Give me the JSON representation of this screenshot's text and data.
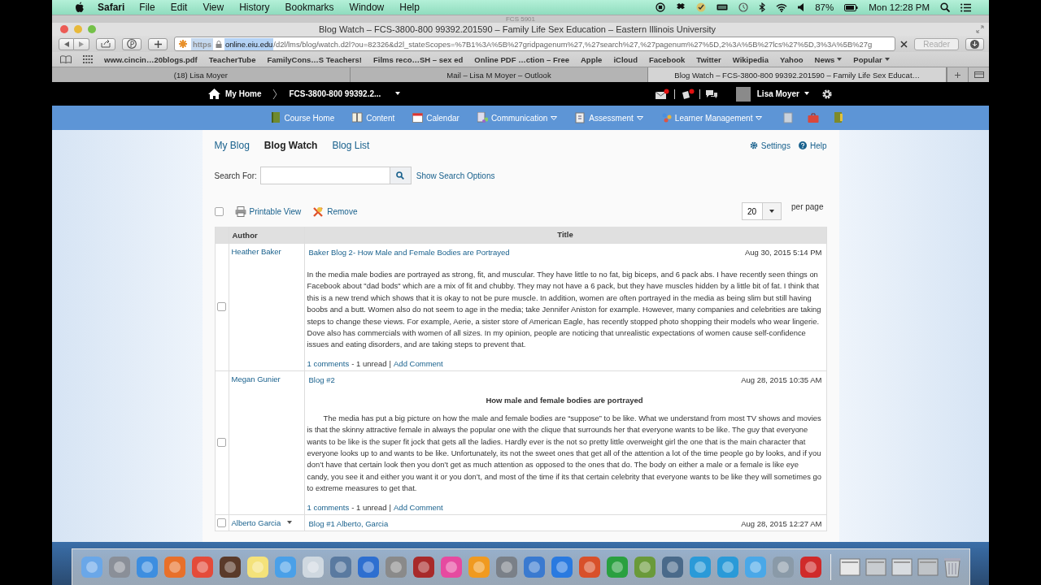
{
  "menu_bar": {
    "app": "Safari",
    "items": [
      "File",
      "Edit",
      "View",
      "History",
      "Bookmarks",
      "Window",
      "Help"
    ],
    "battery": "87%",
    "clock": "Mon 12:28 PM"
  },
  "background_window": {
    "title": "FCS 5901"
  },
  "window": {
    "title": "Blog Watch – FCS-3800-800 99392.201590 – Family Life Sex Education – Eastern Illinois University"
  },
  "address_bar": {
    "scheme": "https",
    "host": "online.eiu.edu",
    "path": "/d2l/lms/blog/watch.d2l?ou=82326&d2l_stateScopes=%7B1%3A%5B%27gridpagenum%27,%27search%27,%27pagenum%27%5D,2%3A%5B%27lcs%27%5D,3%3A%5B%27g",
    "reader": "Reader"
  },
  "bookmarks": [
    {
      "label": "www.cincin…20blogs.pdf",
      "menu": false
    },
    {
      "label": "TeacherTube",
      "menu": false
    },
    {
      "label": "FamilyCons…S Teachers!",
      "menu": false
    },
    {
      "label": "Films reco…SH – sex ed",
      "menu": false
    },
    {
      "label": "Online PDF …ction – Free",
      "menu": false
    },
    {
      "label": "Apple",
      "menu": false
    },
    {
      "label": "iCloud",
      "menu": false
    },
    {
      "label": "Facebook",
      "menu": false
    },
    {
      "label": "Twitter",
      "menu": false
    },
    {
      "label": "Wikipedia",
      "menu": false
    },
    {
      "label": "Yahoo",
      "menu": false
    },
    {
      "label": "News",
      "menu": true
    },
    {
      "label": "Popular",
      "menu": true
    }
  ],
  "tabs": [
    {
      "label": "(18) Lisa Moyer",
      "selected": false
    },
    {
      "label": "Mail – Lisa M Moyer – Outlook",
      "selected": false
    },
    {
      "label": "Blog Watch – FCS-3800-800 99392.201590 – Family Life Sex Educat…",
      "selected": true
    }
  ],
  "top_bar": {
    "home": "My Home",
    "course": "FCS-3800-800 99392.2...",
    "user": "Lisa Moyer"
  },
  "nav": [
    {
      "label": "Course Home",
      "menu": false
    },
    {
      "label": "Content",
      "menu": false
    },
    {
      "label": "Calendar",
      "menu": false
    },
    {
      "label": "Communication",
      "menu": true
    },
    {
      "label": "Assessment",
      "menu": true
    },
    {
      "label": "Learner Management",
      "menu": true
    }
  ],
  "blog_tabs": [
    {
      "label": "My Blog",
      "selected": false
    },
    {
      "label": "Blog Watch",
      "selected": true
    },
    {
      "label": "Blog List",
      "selected": false
    }
  ],
  "links": {
    "settings": "Settings",
    "help": "Help"
  },
  "search": {
    "label": "Search For:",
    "options": "Show Search Options"
  },
  "actions": {
    "print": "Printable View",
    "remove": "Remove",
    "page_size": "20",
    "per_page": "per page",
    "select_all": false
  },
  "table": {
    "columns": [
      "Author",
      "Title"
    ],
    "rows": [
      {
        "author": "Heather Baker",
        "menu": false,
        "checked": false,
        "title": "Baker Blog 2- How Male and Female Bodies are Portrayed",
        "date": "Aug 30, 2015 5:14 PM",
        "body": "In the media male bodies are portrayed as strong, fit, and muscular. They have little to no fat, big biceps, and 6 pack abs. I have recently seen things on Facebook about \"dad bods\" which are a mix of fit and chubby. They may not have a 6 pack, but they have muscles hidden by a little bit of fat. I think that this is a new trend which shows that it is okay to not be pure muscle. In addition, women are often portrayed in the media as being slim but still having boobs and a butt. Women also do not seem to age in the media; take Jennifer Aniston for example. However, many companies and celebrities are taking steps to change these views. For example, Aerie, a sister store of American Eagle, has recently stopped photo shopping their models who wear lingerie. Dove also has commercials with women of all sizes. In my opinion, people are noticing that unrealistic expectations of women cause self-confidence issues and eating disorders, and are taking steps to prevent that.",
        "comments": "1 comments",
        "unread": "- 1 unread",
        "separator": "|",
        "add_comment": "Add Comment"
      },
      {
        "author": "Megan Gunier",
        "menu": false,
        "checked": false,
        "title": "Blog #2",
        "date": "Aug 28, 2015 10:35 AM",
        "subtitle": "How male and female bodies are portrayed",
        "body": "The media has put a big picture on how the male and female bodies are “suppose” to be like. What we understand from most TV shows and movies is that the skinny attractive female in always the popular one with the clique that surrounds her that everyone wants to be like. The guy that everyone wants to be like is the super fit jock that gets all the ladies. Hardly ever is the not so pretty little overweight girl the one that is the main character that everyone looks up to and wants to be like. Unfortunately, its not the sweet ones that get all of the attention a lot of the time people go by looks, and if you don’t have that certain look then you don’t get as much attention as opposed to the ones that do. The body on either a male or a female is like eye candy, you see it and either you want it or you don’t, and most of the time if its that certain celebrity that everyone wants to be like they will sometimes go to extreme measures to get that.",
        "indent": true,
        "comments": "1 comments",
        "unread": "- 1 unread",
        "separator": "|",
        "add_comment": "Add Comment"
      },
      {
        "author": "Alberto Garcia",
        "menu": true,
        "checked": false,
        "title": "Blog #1 Alberto, Garcia",
        "date": "Aug 28, 2015 12:27 AM"
      }
    ]
  }
}
